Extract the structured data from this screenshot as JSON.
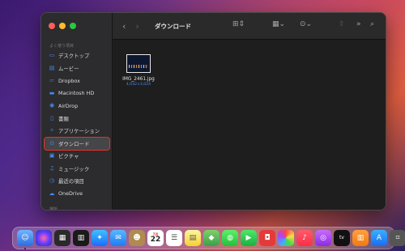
{
  "window": {
    "title": "ダウンロード"
  },
  "sidebar": {
    "section_favorites": "よく使う項目",
    "section_locations": "場所",
    "items": [
      {
        "label": "デスクトップ",
        "icon": "desktop-icon"
      },
      {
        "label": "ムービー",
        "icon": "film-icon"
      },
      {
        "label": "Dropbox",
        "icon": "dropbox-icon"
      },
      {
        "label": "Macintosh HD",
        "icon": "drive-icon"
      },
      {
        "label": "AirDrop",
        "icon": "airdrop-icon"
      },
      {
        "label": "書類",
        "icon": "document-icon"
      },
      {
        "label": "アプリケーション",
        "icon": "applications-icon"
      },
      {
        "label": "ダウンロード",
        "icon": "download-icon",
        "selected": true
      },
      {
        "label": "ピクチャ",
        "icon": "picture-icon"
      },
      {
        "label": "ミュージック",
        "icon": "music-icon"
      },
      {
        "label": "最近の項目",
        "icon": "clock-icon"
      },
      {
        "label": "OneDrive",
        "icon": "cloud-icon"
      }
    ]
  },
  "files": [
    {
      "name": "IMG_2461.jpg",
      "dimensions": "4,032×3,024"
    }
  ],
  "dock": {
    "calendar_month": "7月",
    "calendar_day": "22",
    "tv_label": "tv"
  },
  "colors": {
    "accent": "#3d8ef7",
    "highlight_box": "#e0342b"
  }
}
